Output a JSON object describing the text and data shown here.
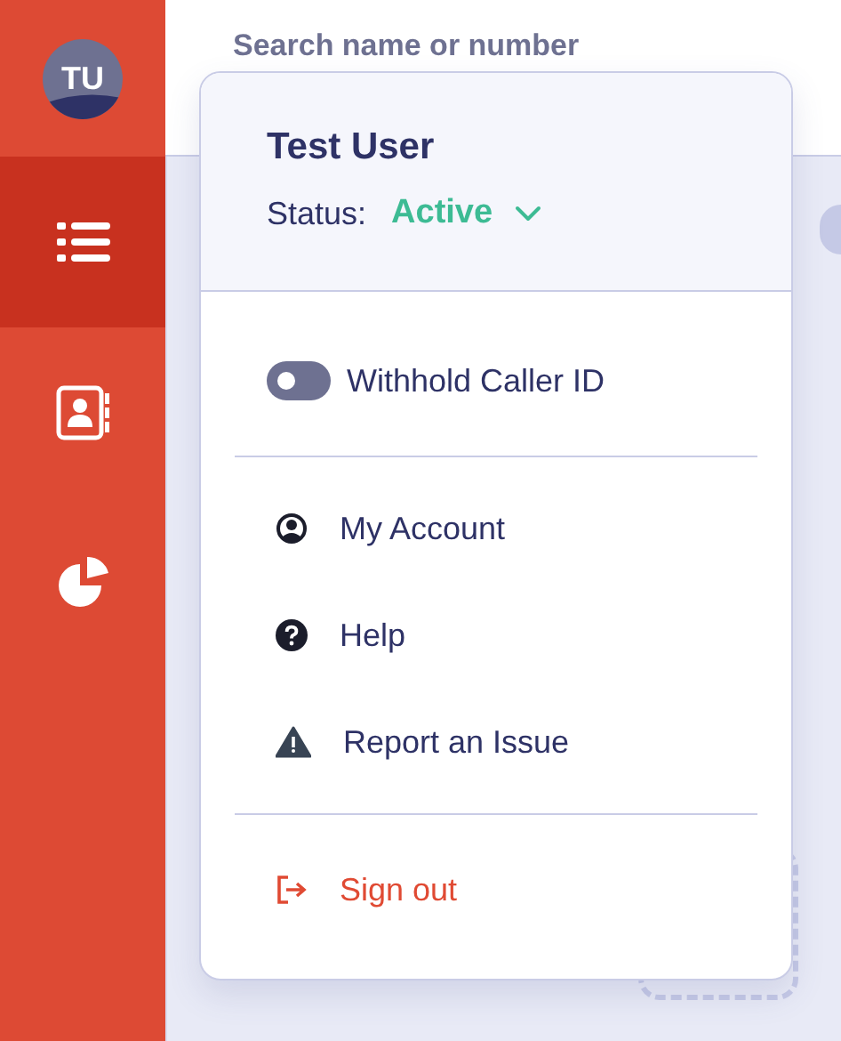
{
  "sidebar": {
    "avatar": {
      "initials": "TU"
    },
    "items": [
      {
        "kind": "list",
        "selected": true
      },
      {
        "kind": "contacts",
        "selected": false
      },
      {
        "kind": "chart",
        "selected": false
      }
    ]
  },
  "search": {
    "placeholder": "Search name or number"
  },
  "menu": {
    "user_name": "Test User",
    "status_label": "Status:",
    "status_value": "Active",
    "toggle": {
      "label": "Withhold Caller ID",
      "checked": false
    },
    "items": [
      {
        "kind": "account",
        "label": "My Account"
      },
      {
        "kind": "help",
        "label": "Help"
      },
      {
        "kind": "report",
        "label": "Report an Issue"
      }
    ],
    "sign_out": {
      "label": "Sign out"
    }
  }
}
